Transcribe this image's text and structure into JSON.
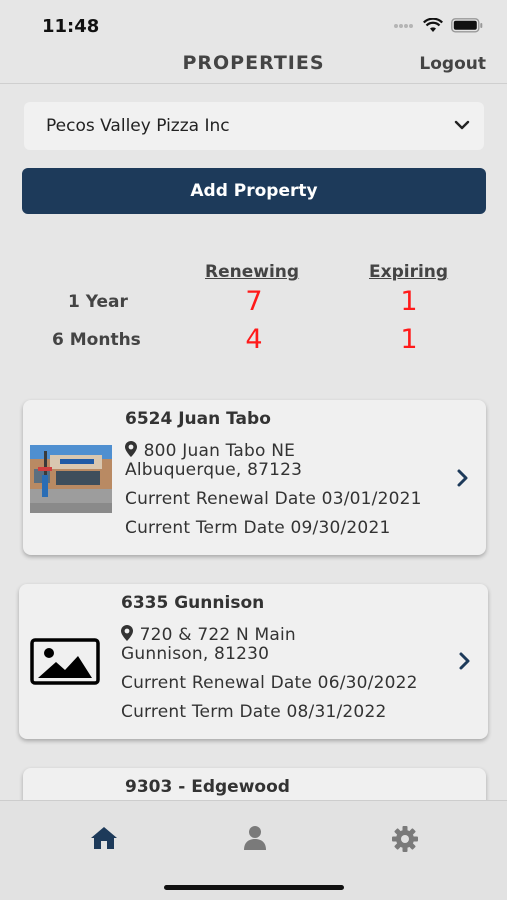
{
  "status_bar": {
    "time": "11:48"
  },
  "header": {
    "title": "PROPERTIES",
    "logout_label": "Logout"
  },
  "company_select": {
    "value": "Pecos Valley Pizza Inc"
  },
  "add_property_label": "Add Property",
  "summary": {
    "renewing_header": "Renewing",
    "expiring_header": "Expiring",
    "rows": [
      {
        "label": "1 Year",
        "renewing": "7",
        "expiring": "1"
      },
      {
        "label": "6 Months",
        "renewing": "4",
        "expiring": "1"
      }
    ],
    "value_color": "#ff1a1a"
  },
  "properties": [
    {
      "name": "6524 Juan Tabo",
      "address_line1": "800 Juan Tabo NE",
      "address_line2": "Albuquerque,  87123",
      "renewal": "Current Renewal Date 03/01/2021",
      "term": "Current Term Date 09/30/2021",
      "image": "storefront-photo"
    },
    {
      "name": "6335 Gunnison",
      "address_line1": "720 & 722 N Main",
      "address_line2": "Gunnison,  81230",
      "renewal": "Current Renewal Date 06/30/2022",
      "term": "Current Term Date 08/31/2022",
      "image": "image-placeholder-icon"
    },
    {
      "name": "9303 - Edgewood"
    }
  ],
  "colors": {
    "accent": "#1d3a5a",
    "background": "#e6e6e6"
  },
  "tabbar": {
    "tabs": [
      "home-icon",
      "person-icon",
      "gear-icon"
    ],
    "active": "home-icon"
  }
}
